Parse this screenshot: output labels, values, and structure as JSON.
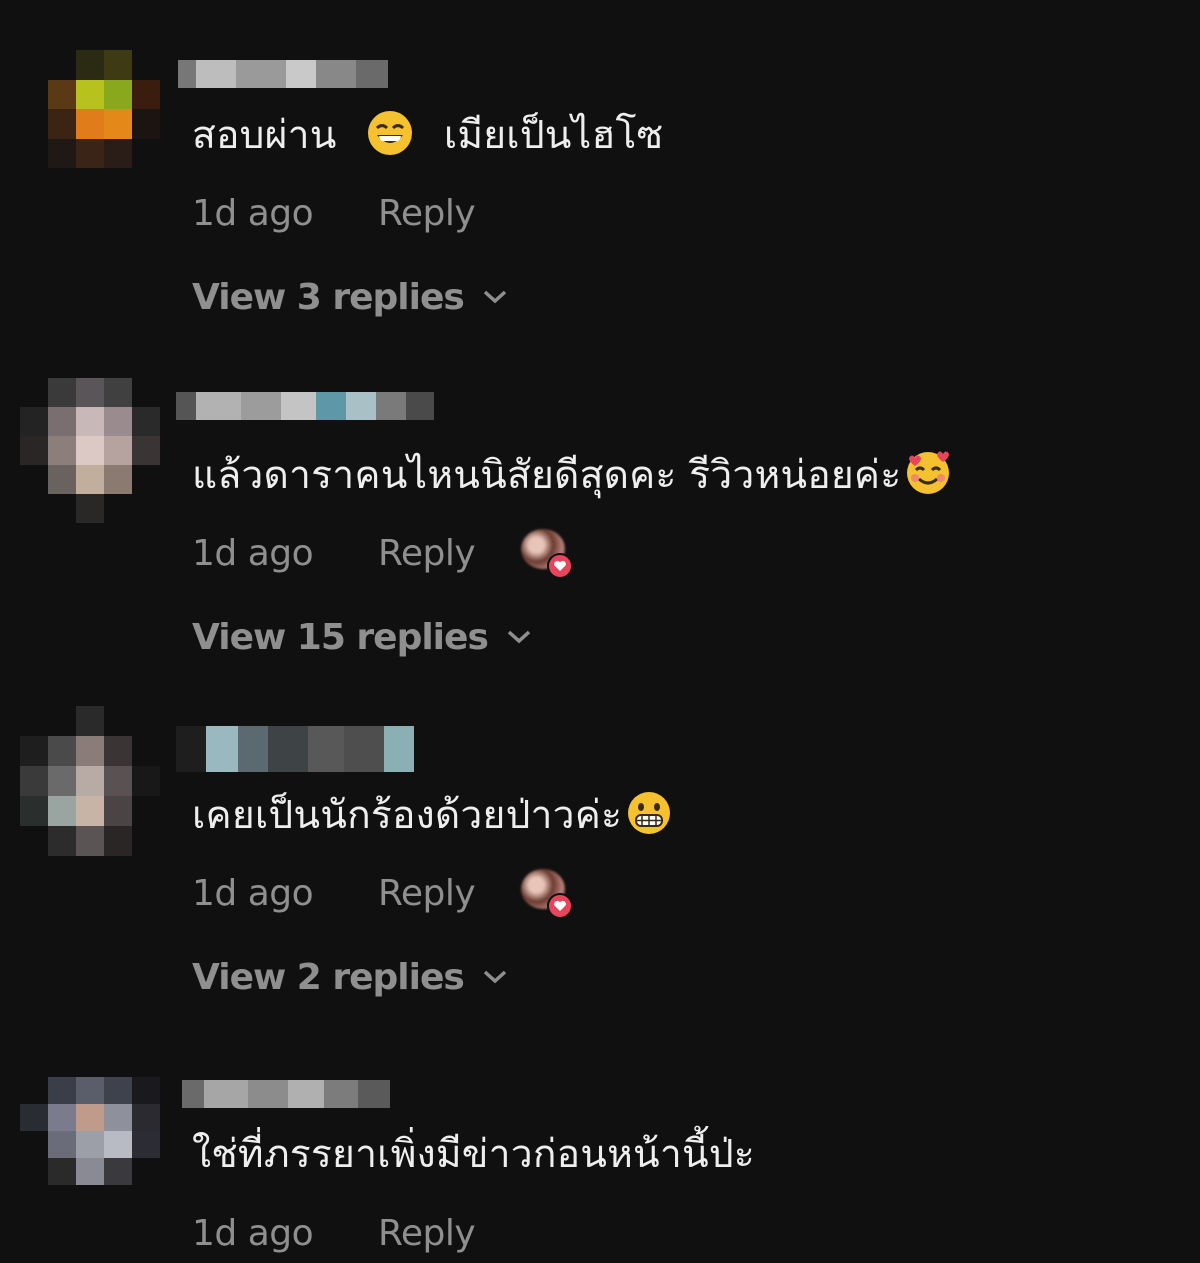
{
  "comments": [
    {
      "text": "สอบผ่าน",
      "text_after": "เมียเป็นไฮโซ",
      "emoji": "grinning-squint-face",
      "time": "1d ago",
      "reply_label": "Reply",
      "view_replies": "View 3 replies",
      "creator_liked": false
    },
    {
      "text": "แล้วดาราคนไหนนิสัยดีสุดคะ รีวิวหน่อยค่ะ",
      "text_after": "",
      "emoji": "smiling-face-with-hearts",
      "time": "1d ago",
      "reply_label": "Reply",
      "view_replies": "View 15 replies",
      "creator_liked": true
    },
    {
      "text": "เคยเป็นนักร้องด้วยป่าวค่ะ",
      "text_after": "",
      "emoji": "grimacing-face",
      "time": "1d ago",
      "reply_label": "Reply",
      "view_replies": "View 2 replies",
      "creator_liked": true
    },
    {
      "text": "ใช่ที่ภรรยาเพิ่งมีข่าวก่อนหน้านี้ป่ะ",
      "text_after": "",
      "emoji": "",
      "time": "1d ago",
      "reply_label": "Reply",
      "view_replies": "",
      "creator_liked": false
    }
  ],
  "colors": {
    "background": "#101010",
    "text": "#eeeeee",
    "muted": "#8f8f8f",
    "like_heart": "#e8455d",
    "emoji_yellow": "#f5c12e"
  }
}
